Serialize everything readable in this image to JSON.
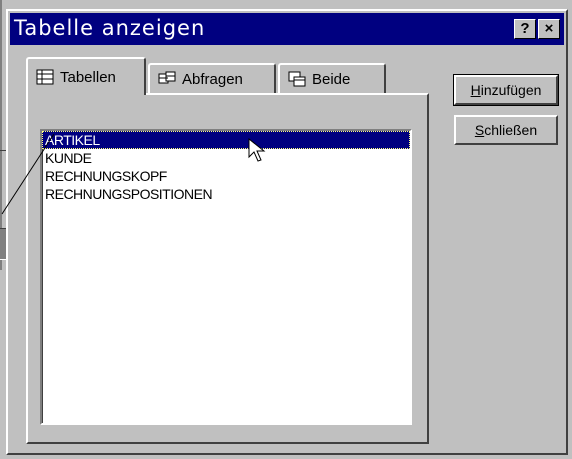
{
  "dialog": {
    "title": "Tabelle anzeigen",
    "help_label": "?",
    "close_label": "×"
  },
  "tabs": [
    {
      "label": "Tabellen",
      "icon": "table-icon",
      "active": true
    },
    {
      "label": "Abfragen",
      "icon": "query-icon",
      "active": false
    },
    {
      "label": "Beide",
      "icon": "both-icon",
      "active": false
    }
  ],
  "list": {
    "items": [
      "ARTIKEL",
      "KUNDE",
      "RECHNUNGSKOPF",
      "RECHNUNGSPOSITIONEN"
    ],
    "selected_index": 0
  },
  "buttons": {
    "add": {
      "mnemonic": "H",
      "rest": "inzufügen"
    },
    "close": {
      "mnemonic": "S",
      "rest": "chließen"
    }
  },
  "colors": {
    "titlebar": "#000080",
    "face": "#c0c0c0",
    "selection": "#000080"
  }
}
